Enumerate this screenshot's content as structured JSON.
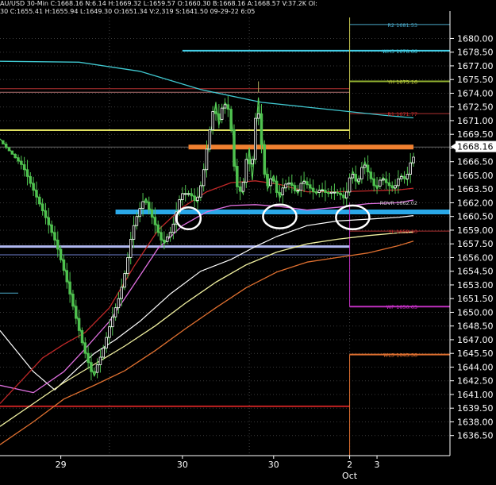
{
  "header": {
    "line1": "AU/USD  30-Min  C:1668.16  N:6.14  H:1669.32  L:1659.57  O:1660.30  B:1668.16  A:1668.57  V:37.2K  OI:",
    "line2": "30  C:1655.41  H:1655.94  L:1649.30  O:1651.34  V:2,319  S:1641.50  09-29-22  6:05"
  },
  "colors": {
    "background": "#000000",
    "axis": "#ffffff",
    "up_candle": "#ffffff",
    "down_candle": "#4fc14f",
    "wick": "#4fc14f",
    "current_price_bg": "#ffffff",
    "current_price_text": "#000000"
  },
  "chart_data": {
    "type": "candlestick",
    "title": "",
    "timeframe": "30-Min",
    "symbol": "AU/USD",
    "ylim": [
      1634.3,
      1682.3
    ],
    "x_domain": [
      -6,
      142
    ],
    "grid": true,
    "y_ticks": [
      "1680.00",
      "1678.50",
      "1677.00",
      "1675.50",
      "1674.00",
      "1672.50",
      "1671.00",
      "1669.50",
      "1668.00",
      "1666.50",
      "1665.00",
      "1663.50",
      "1662.00",
      "1660.50",
      "1659.00",
      "1657.50",
      "1656.00",
      "1654.50",
      "1653.00",
      "1651.50",
      "1650.00",
      "1648.50",
      "1647.00",
      "1645.50",
      "1644.00",
      "1642.50",
      "1641.00",
      "1639.50",
      "1638.00",
      "1636.50"
    ],
    "current_price": "1668.16",
    "x_ticks": [
      {
        "label": "29",
        "x": 14
      },
      {
        "label": "30",
        "x": 54
      },
      {
        "label": "30",
        "x": 84
      },
      {
        "label": "2",
        "x": 109
      },
      {
        "label": "3",
        "x": 118
      }
    ],
    "month_label": {
      "label": "Oct",
      "x": 109
    },
    "vertical_grid_x": [
      30,
      76,
      109
    ],
    "labels": [
      {
        "text": "R2 1681.53",
        "y": 1681.53,
        "color": "#4aa8c8"
      },
      {
        "text": "WH3 1678.66",
        "y": 1678.66,
        "color": "#45d0e8"
      },
      {
        "text": "YH 1675.16",
        "y": 1675.3,
        "color": "#c8d040"
      },
      {
        "text": "R1 1671.77",
        "y": 1671.77,
        "color": "#d03030"
      },
      {
        "text": "ROVR 1662.02",
        "y": 1662.02,
        "color": "#cccccc"
      },
      {
        "text": "YL 1659.10",
        "y": 1658.9,
        "color": "#d03030"
      },
      {
        "text": "WP 1650.63",
        "y": 1650.63,
        "color": "#d030d0"
      },
      {
        "text": "WL3 1645.38",
        "y": 1645.38,
        "color": "#e07030"
      }
    ],
    "levels": [
      {
        "y": 1681.53,
        "x0": 109,
        "x1": 142,
        "color": "#4aa8c8",
        "width": 1
      },
      {
        "y": 1678.66,
        "x0": 54,
        "x1": 142,
        "color": "#45d0e8",
        "width": 2
      },
      {
        "y": 1675.3,
        "x0": 109,
        "x1": 142,
        "color": "#90b030",
        "width": 2
      },
      {
        "y": 1674.5,
        "x0": -6,
        "x1": 109,
        "color": "#b03030",
        "width": 1
      },
      {
        "y": 1674.1,
        "x0": -6,
        "x1": 109,
        "color": "#b07070",
        "width": 1
      },
      {
        "y": 1671.77,
        "x0": 109,
        "x1": 142,
        "color": "#b03030",
        "width": 1
      },
      {
        "y": 1669.95,
        "x0": -6,
        "x1": 109,
        "color": "#e0e060",
        "width": 2
      },
      {
        "y": 1668.1,
        "x0": -6,
        "x1": 142,
        "color": "#666666",
        "width": 1
      },
      {
        "y": 1668.1,
        "x0": 56,
        "x1": 130,
        "color": "#f08030",
        "width": 6
      },
      {
        "y": 1661.0,
        "x0": 32,
        "x1": 142,
        "color": "#2aa8e8",
        "width": 6
      },
      {
        "y": 1658.9,
        "x0": 109,
        "x1": 142,
        "color": "#b03030",
        "width": 1
      },
      {
        "y": 1657.2,
        "x0": -6,
        "x1": 109,
        "color": "#b0b8f0",
        "width": 3
      },
      {
        "y": 1656.3,
        "x0": -6,
        "x1": 109,
        "color": "#7080d0",
        "width": 1
      },
      {
        "y": 1652.1,
        "x0": -6,
        "x1": 0,
        "color": "#4aa8c8",
        "width": 1
      },
      {
        "y": 1650.63,
        "x0": 109,
        "x1": 142,
        "color": "#c030c0",
        "width": 2
      },
      {
        "y": 1645.38,
        "x0": 109,
        "x1": 142,
        "color": "#e07030",
        "width": 2
      },
      {
        "y": 1639.7,
        "x0": -6,
        "x1": 109,
        "color": "#c02020",
        "width": 2
      }
    ],
    "vlines": [
      {
        "x": 109,
        "y0": 1682.3,
        "y1": 1669.0,
        "color": "#c8c850",
        "width": 1
      },
      {
        "x": 109,
        "y0": 1662.0,
        "y1": 1650.6,
        "color": "#c030c0",
        "width": 1
      },
      {
        "x": 109,
        "y0": 1645.38,
        "y1": 1634.3,
        "color": "#e07030",
        "width": 1
      },
      {
        "x": 79,
        "y0": 1675.3,
        "y1": 1674.1,
        "color": "#b0b060",
        "width": 1
      }
    ],
    "ellipses": [
      {
        "cx": 56,
        "cy": 1660.3,
        "rx": 4.0,
        "ry": 1.2
      },
      {
        "cx": 86,
        "cy": 1660.5,
        "rx": 5.5,
        "ry": 1.3
      },
      {
        "cx": 110,
        "cy": 1660.4,
        "rx": 5.5,
        "ry": 1.3
      }
    ],
    "series": [
      {
        "name": "",
        "color": "#40c8d0",
        "width": 1.3,
        "x": [
          -6,
          20,
          40,
          60,
          80,
          100,
          120,
          130
        ],
        "y": [
          1677.5,
          1677.4,
          1676.4,
          1674.4,
          1673.0,
          1672.3,
          1671.6,
          1671.3
        ]
      },
      {
        "name": "",
        "color": "#ffffff",
        "width": 1.2,
        "x": [
          -6,
          5,
          12,
          20,
          25,
          32,
          40,
          50,
          60,
          70,
          78,
          85,
          95,
          105,
          115,
          125,
          130
        ],
        "y": [
          1648.0,
          1643.5,
          1641.5,
          1644.0,
          1645.5,
          1647.0,
          1649.0,
          1652.0,
          1654.5,
          1655.8,
          1657.2,
          1658.3,
          1659.5,
          1660.0,
          1660.2,
          1660.4,
          1660.6
        ]
      },
      {
        "name": "",
        "color": "#f0f0a0",
        "width": 1.3,
        "x": [
          -6,
          5,
          15,
          25,
          35,
          45,
          55,
          65,
          75,
          85,
          95,
          105,
          115,
          125,
          130
        ],
        "y": [
          1637.5,
          1640.0,
          1642.3,
          1644.3,
          1646.3,
          1648.5,
          1651.0,
          1653.3,
          1655.2,
          1656.6,
          1657.5,
          1658.0,
          1658.4,
          1658.7,
          1658.8
        ]
      },
      {
        "name": "",
        "color": "#e070e0",
        "width": 1.3,
        "x": [
          -6,
          5,
          15,
          22,
          30,
          38,
          46,
          54,
          62,
          70,
          78,
          86,
          95,
          105,
          115,
          125,
          130
        ],
        "y": [
          1642.0,
          1641.2,
          1643.5,
          1646.0,
          1649.0,
          1653.0,
          1657.0,
          1659.5,
          1661.0,
          1661.7,
          1661.8,
          1661.6,
          1661.2,
          1661.5,
          1661.9,
          1662.0,
          1662.3
        ]
      },
      {
        "name": "",
        "color": "#c02828",
        "width": 1.3,
        "x": [
          -6,
          8,
          15,
          22,
          30,
          38,
          46,
          54,
          62,
          70,
          78,
          86,
          95,
          105,
          115,
          125,
          130
        ],
        "y": [
          1640.0,
          1645.0,
          1646.5,
          1647.8,
          1650.5,
          1655.0,
          1659.0,
          1661.5,
          1663.2,
          1664.2,
          1664.4,
          1664.0,
          1663.2,
          1663.2,
          1663.3,
          1663.4,
          1663.6
        ]
      },
      {
        "name": "",
        "color": "#e07030",
        "width": 1.3,
        "x": [
          -6,
          5,
          15,
          25,
          35,
          45,
          55,
          65,
          75,
          85,
          95,
          105,
          115,
          125,
          130
        ],
        "y": [
          1635.5,
          1638.0,
          1640.5,
          1642.0,
          1643.6,
          1645.8,
          1648.2,
          1650.5,
          1652.7,
          1654.4,
          1655.5,
          1656.0,
          1656.5,
          1657.3,
          1657.8
        ]
      },
      {
        "name": "",
        "color": "#58d058",
        "width": 1.2,
        "x": [
          -6,
          2,
          6,
          10,
          13,
          16,
          19,
          22,
          25,
          28,
          31,
          34,
          36,
          38,
          40,
          42,
          45,
          48,
          51,
          54,
          57,
          59,
          61,
          63,
          65,
          66,
          68,
          70,
          72,
          74,
          76,
          77,
          79,
          80,
          82,
          84,
          86,
          88,
          90,
          92,
          94,
          96,
          98,
          100,
          102,
          104,
          106,
          108,
          110,
          112,
          114,
          116,
          118,
          120,
          122,
          124,
          126,
          128,
          130
        ],
        "y": [
          1669.0,
          1666.0,
          1663.0,
          1660.0,
          1657.5,
          1654.0,
          1650.0,
          1646.0,
          1643.0,
          1645.5,
          1649.0,
          1652.0,
          1655.0,
          1659.0,
          1661.0,
          1662.5,
          1660.0,
          1657.5,
          1659.0,
          1663.0,
          1663.0,
          1662.0,
          1664.5,
          1669.0,
          1673.0,
          1670.5,
          1673.0,
          1672.0,
          1664.0,
          1663.0,
          1668.0,
          1664.5,
          1673.5,
          1670.0,
          1663.5,
          1665.0,
          1662.5,
          1664.0,
          1664.2,
          1663.0,
          1664.5,
          1663.8,
          1663.0,
          1663.5,
          1663.0,
          1663.2,
          1663.0,
          1662.4,
          1665.5,
          1664.0,
          1666.5,
          1665.0,
          1663.5,
          1664.8,
          1664.0,
          1663.5,
          1665.0,
          1664.5,
          1667.0
        ]
      }
    ]
  }
}
